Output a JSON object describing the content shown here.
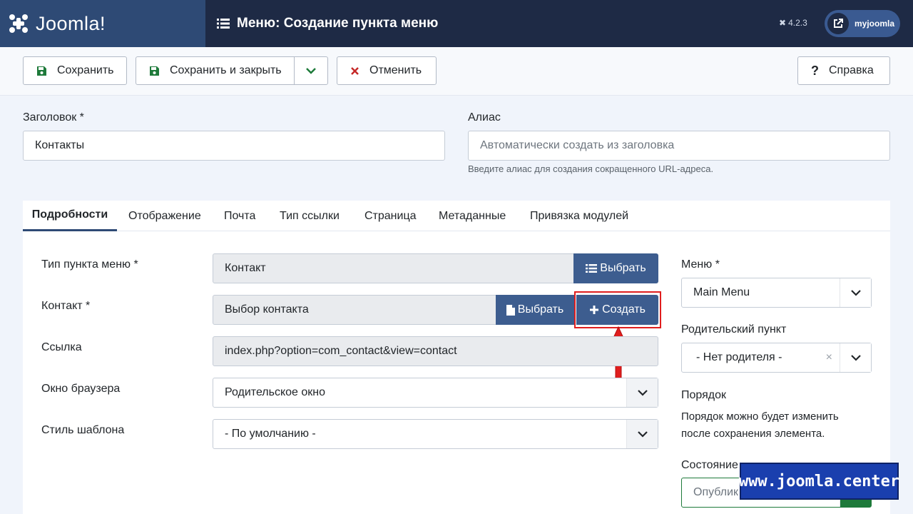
{
  "header": {
    "brand": "Joomla!",
    "title": "Меню: Создание пункта меню",
    "version": "4.2.3",
    "user": "myjoomla"
  },
  "toolbar": {
    "save": "Сохранить",
    "save_close": "Сохранить и закрыть",
    "cancel": "Отменить",
    "help": "Справка"
  },
  "form": {
    "title_label": "Заголовок *",
    "title_value": "Контакты",
    "alias_label": "Алиас",
    "alias_placeholder": "Автоматически создать из заголовка",
    "alias_hint": "Введите алиас для создания сокращенного URL-адреса."
  },
  "tabs": [
    "Подробности",
    "Отображение",
    "Почта",
    "Тип ссылки",
    "Страница",
    "Метаданные",
    "Привязка модулей"
  ],
  "details": {
    "menu_item_type_label": "Тип пункта меню *",
    "menu_item_type_value": "Контакт",
    "select_btn": "Выбрать",
    "contact_label": "Контакт *",
    "contact_value": "Выбор контакта",
    "create_btn": "Создать",
    "link_label": "Ссылка",
    "link_value": "index.php?option=com_contact&view=contact",
    "browser_label": "Окно браузера",
    "browser_value": "Родительское окно",
    "style_label": "Стиль шаблона",
    "style_value": "- По умолчанию -"
  },
  "sidebar": {
    "menu_label": "Меню *",
    "menu_value": "Main Menu",
    "parent_label": "Родительский пункт",
    "parent_value": "- Нет родителя -",
    "order_label": "Порядок",
    "order_text_1": "Порядок можно будет изменить",
    "order_text_2": "после сохранения элемента.",
    "state_label": "Состояние",
    "state_value": "Опублик"
  },
  "watermark": "www.joomla.center",
  "colors": {
    "header": "#1e2a45",
    "logo_bg": "#2e4a75",
    "primary_btn": "#3d5d8f",
    "highlight": "#e01e1e"
  }
}
